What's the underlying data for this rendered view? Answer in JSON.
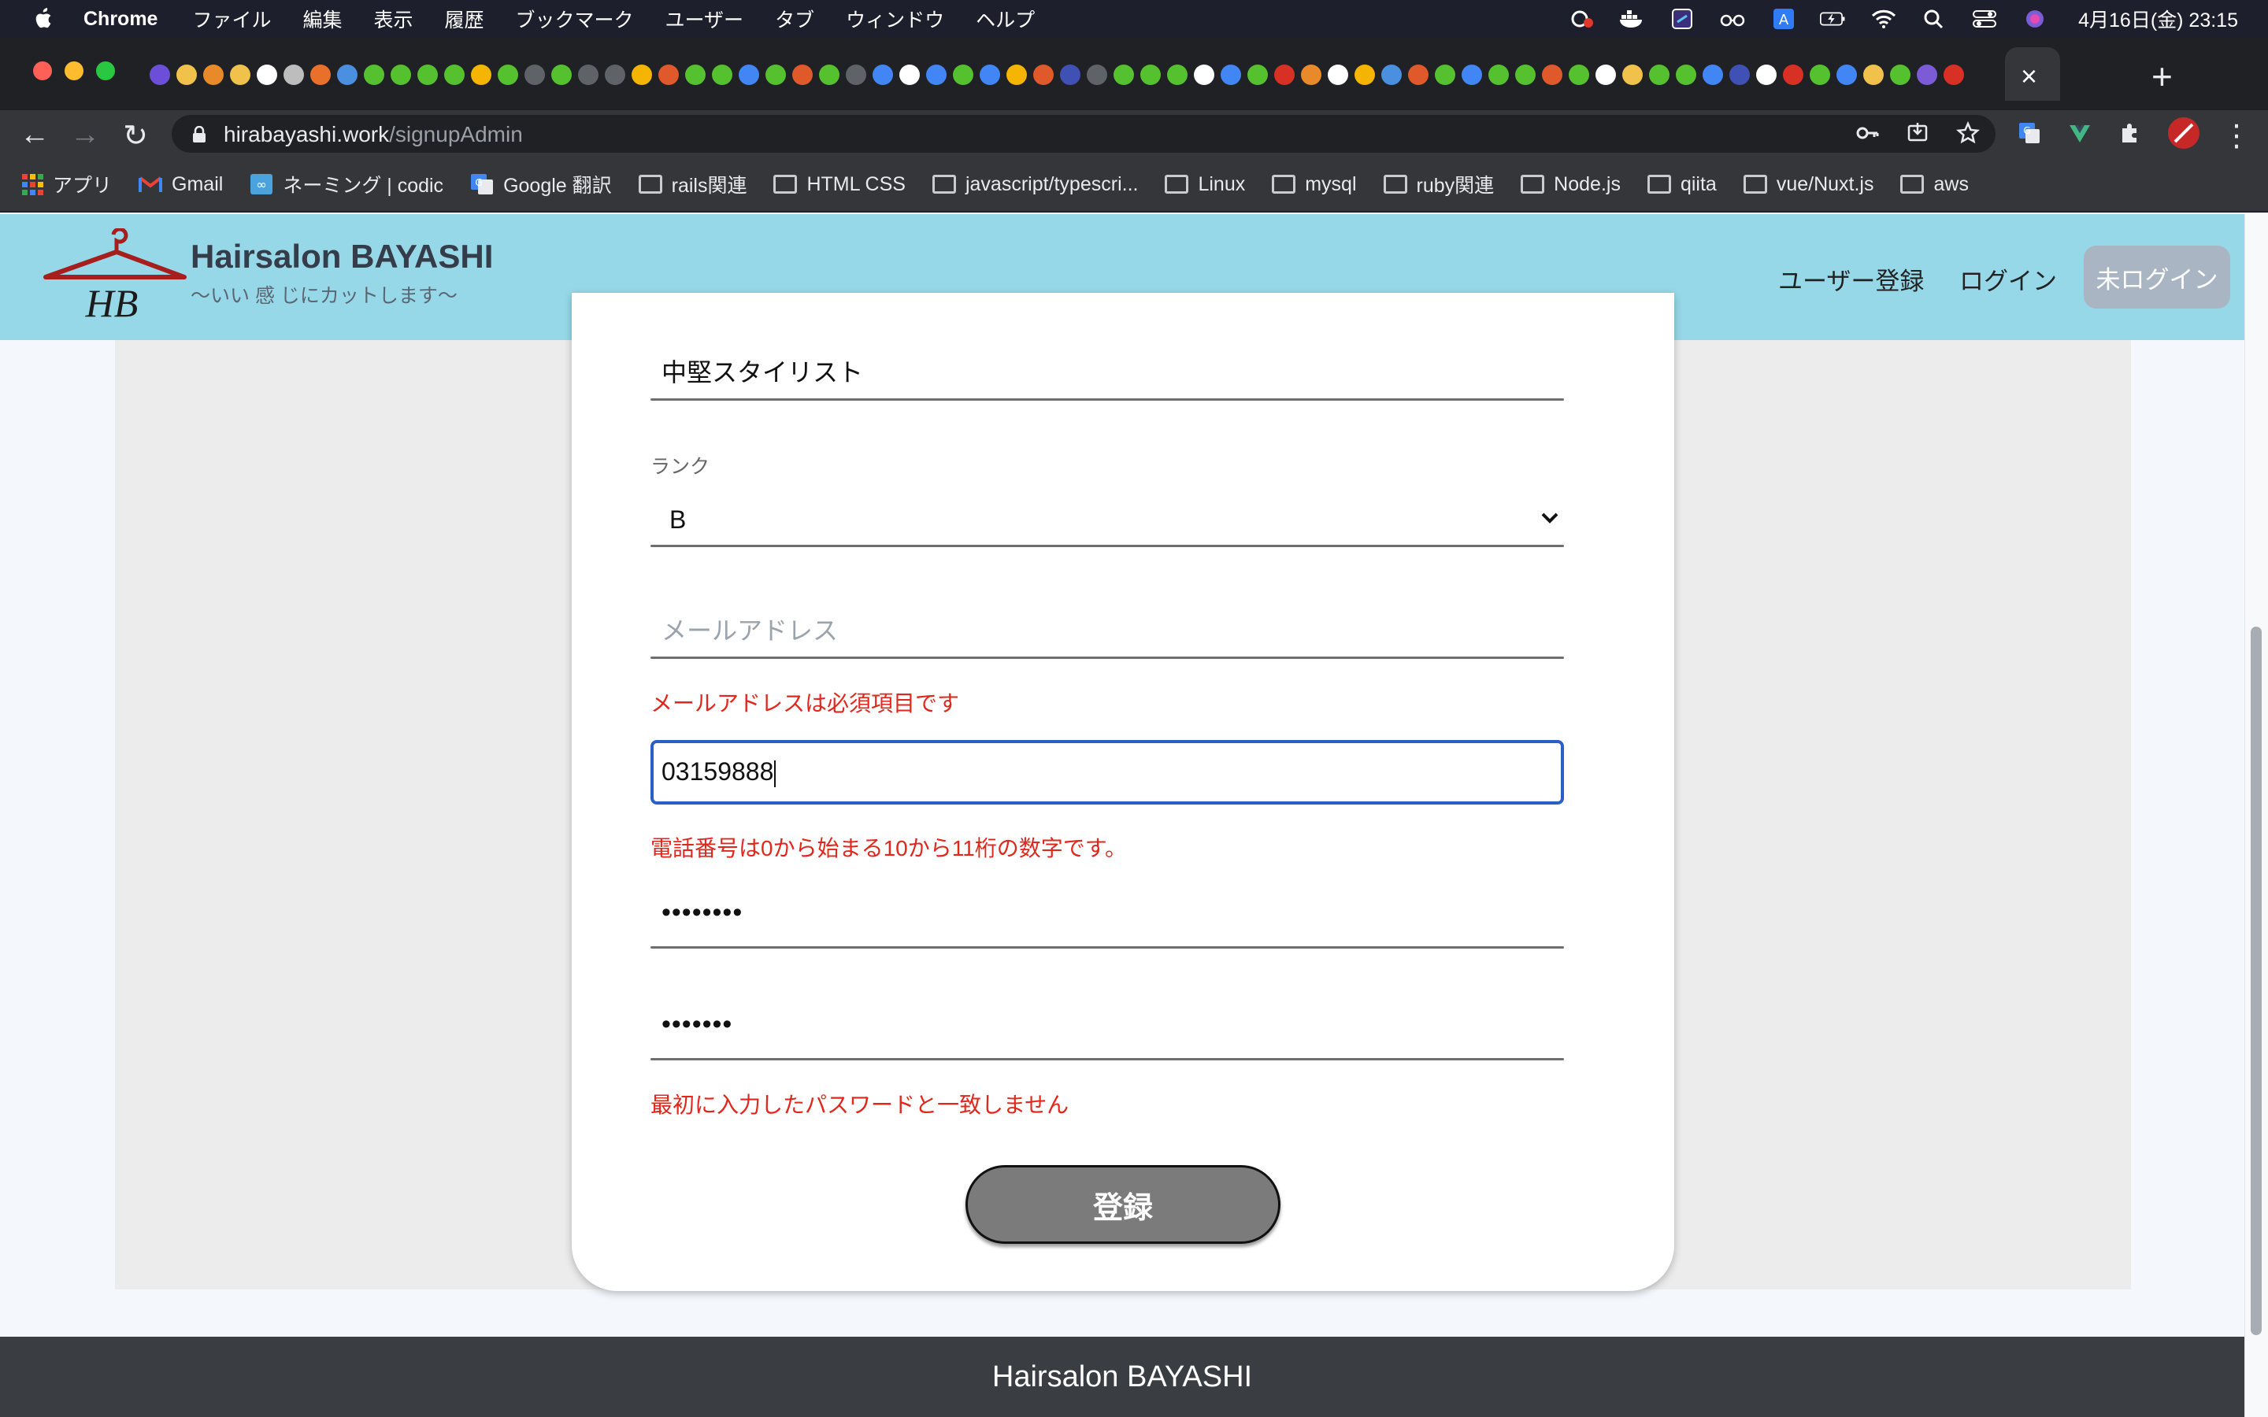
{
  "menubar": {
    "app_name": "Chrome",
    "menus": [
      "ファイル",
      "編集",
      "表示",
      "履歴",
      "ブックマーク",
      "ユーザー",
      "タブ",
      "ウィンドウ",
      "ヘルプ"
    ],
    "datetime": "4月16日(金)  23:15"
  },
  "browser": {
    "url_host": "hirabayashi.work",
    "url_path": "/signupAdmin",
    "new_tab_symbol": "+",
    "close_tab_symbol": "×"
  },
  "bookmarks": [
    {
      "label": "アプリ",
      "icon": "apps-grid-icon"
    },
    {
      "label": "Gmail",
      "icon": "gmail-icon"
    },
    {
      "label": "ネーミング | codic",
      "icon": "codic-icon"
    },
    {
      "label": "Google 翻訳",
      "icon": "google-translate-icon"
    },
    {
      "label": "rails関連",
      "icon": "folder-icon"
    },
    {
      "label": "HTML CSS",
      "icon": "folder-icon"
    },
    {
      "label": "javascript/typescri...",
      "icon": "folder-icon"
    },
    {
      "label": "Linux",
      "icon": "folder-icon"
    },
    {
      "label": "mysql",
      "icon": "folder-icon"
    },
    {
      "label": "ruby関連",
      "icon": "folder-icon"
    },
    {
      "label": "Node.js",
      "icon": "folder-icon"
    },
    {
      "label": "qiita",
      "icon": "folder-icon"
    },
    {
      "label": "vue/Nuxt.js",
      "icon": "folder-icon"
    },
    {
      "label": "aws",
      "icon": "folder-icon"
    }
  ],
  "site": {
    "logo_text": "HB",
    "brand": "Hairsalon BAYASHI",
    "tagline": "〜いい 感 じにカットします〜",
    "nav": {
      "signup": "ユーザー登録",
      "login": "ログイン",
      "status": "未ログイン"
    }
  },
  "form": {
    "position_value": "中堅スタイリスト",
    "rank_label": "ランク",
    "rank_value": "B",
    "email_placeholder": "メールアドレス",
    "email_error": "メールアドレスは必須項目です",
    "phone_value": "03159888",
    "phone_error": "電話番号は0から始まる10から11桁の数字です。",
    "password_mask": "••••••••",
    "password_confirm_mask": "•••••••",
    "password_error": "最初に入力したパスワードと一致しません",
    "submit_label": "登録"
  },
  "footer": {
    "text": "Hairsalon BAYASHI"
  },
  "colors": {
    "header_bg": "#97d8e8",
    "error": "#e1261c",
    "focus_border": "#2a5fc8",
    "submit_bg": "#7b7b7b",
    "footer_bg": "#3a3d41"
  }
}
